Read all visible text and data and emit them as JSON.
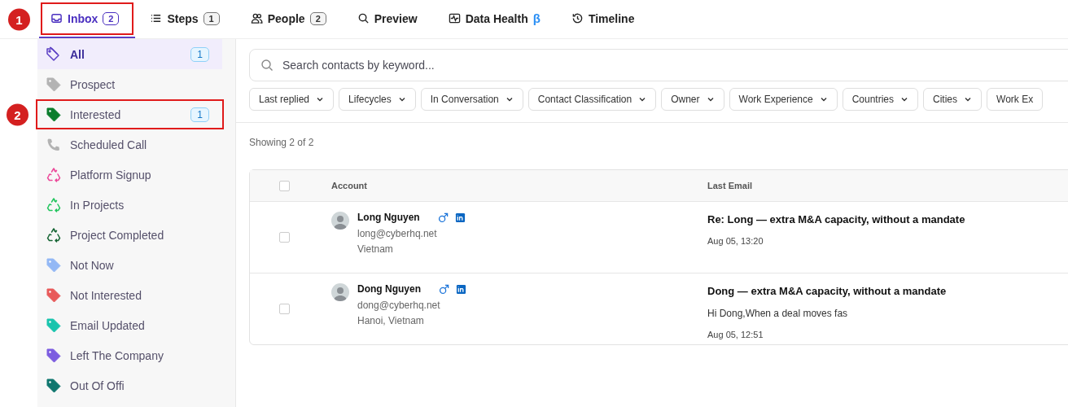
{
  "tabs": [
    {
      "label": "Inbox",
      "count": "2",
      "selected": true,
      "marker": "1"
    },
    {
      "label": "Steps",
      "count": "1",
      "selected": false
    },
    {
      "label": "People",
      "count": "2",
      "selected": false
    },
    {
      "label": "Preview",
      "selected": false
    },
    {
      "label": "Data Health",
      "suffix": "β",
      "selected": false
    },
    {
      "label": "Timeline",
      "selected": false
    }
  ],
  "sidebar": {
    "items": [
      {
        "label": "All",
        "kind": "tags",
        "color": "#5b3fc4",
        "count": "1",
        "selected": true
      },
      {
        "label": "Prospect",
        "kind": "tag",
        "color": "#b3b3b3",
        "selected": false
      },
      {
        "label": "Interested",
        "kind": "tag",
        "color": "#0b7d2c",
        "count": "1",
        "selected": false,
        "marker": "2"
      },
      {
        "label": "Scheduled Call",
        "kind": "phone",
        "color": "#b3b3b3",
        "selected": false
      },
      {
        "label": "Platform Signup",
        "kind": "recycle",
        "color": "#ec4899",
        "selected": false
      },
      {
        "label": "In Projects",
        "kind": "recycle",
        "color": "#22c55e",
        "selected": false
      },
      {
        "label": "Project Completed",
        "kind": "recycle",
        "color": "#166534",
        "selected": false
      },
      {
        "label": "Not Now",
        "kind": "tag",
        "color": "#93b8f5",
        "selected": false
      },
      {
        "label": "Not Interested",
        "kind": "tag",
        "color": "#e85a5a",
        "selected": false
      },
      {
        "label": "Email Updated",
        "kind": "tag",
        "color": "#19c4ad",
        "selected": false
      },
      {
        "label": "Left The Company",
        "kind": "tag",
        "color": "#7c5ce0",
        "selected": false
      },
      {
        "label": "Out Of Offi",
        "kind": "tag",
        "color": "#0f766e",
        "selected": false
      }
    ]
  },
  "search": {
    "placeholder": "Search contacts by keyword..."
  },
  "filters": [
    {
      "label": "Last replied",
      "chevron": true
    },
    {
      "label": "Lifecycles",
      "chevron": true
    },
    {
      "label": "In Conversation",
      "chevron": true
    },
    {
      "label": "Contact Classification",
      "chevron": true
    },
    {
      "label": "Owner",
      "chevron": true
    },
    {
      "label": "Work Experience",
      "chevron": true
    },
    {
      "label": "Countries",
      "chevron": true
    },
    {
      "label": "Cities",
      "chevron": true
    },
    {
      "label": "Work Ex",
      "chevron": false
    }
  ],
  "summary": "Showing 2 of 2",
  "table": {
    "all_checked": false,
    "columns": [
      "Account",
      "Last Email"
    ],
    "rows": [
      {
        "checked": false,
        "name": "Long Nguyen",
        "email": "long@cyberhq.net",
        "location": "Vietnam",
        "subject": "Re: Long — extra M&A capacity, without a mandate",
        "date": "Aug 05, 13:20"
      },
      {
        "checked": false,
        "name": "Dong Nguyen",
        "email": "dong@cyberhq.net",
        "location": "Hanoi, Vietnam",
        "subject": "Dong — extra M&A capacity, without a mandate",
        "preview": "Hi Dong,When a deal moves fas",
        "date": "Aug 05, 12:51"
      }
    ]
  }
}
